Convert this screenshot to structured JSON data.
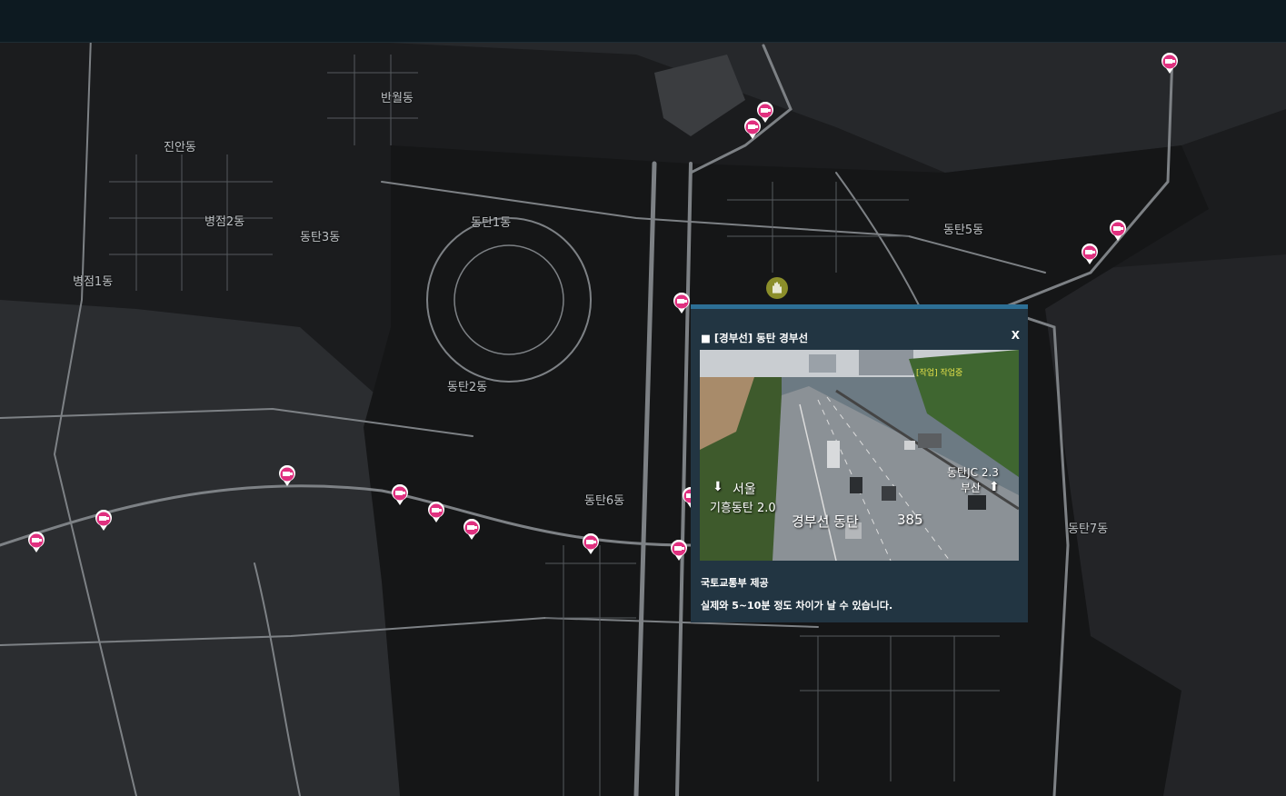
{
  "map": {
    "districts": [
      "반월동",
      "진안동",
      "병점2동",
      "동탄3동",
      "동탄1동",
      "동탄5동",
      "병점1동",
      "동탄2동",
      "동탄6동",
      "동탄7동"
    ],
    "colors": {
      "base": "#1b1c1e",
      "urban": "#2b2d30",
      "roads": "#8a8e92",
      "marker": "#e0307f"
    }
  },
  "popup": {
    "title": "■ [경부선] 동탄 경부선",
    "close": "X",
    "provider": "국토교통부 제공",
    "note": "실제와 5~10분 정도 차이가 날 수 있습니다.",
    "camera": {
      "left_label": "서울",
      "left_sub": "기흥동탄 2.0",
      "right_label": "동탄JC 2.3",
      "right_sub": "부산",
      "bottom_label": "경부선 동탄",
      "km": "385",
      "work": "[작업] 작업중",
      "icon": "arrow-down-icon"
    }
  }
}
